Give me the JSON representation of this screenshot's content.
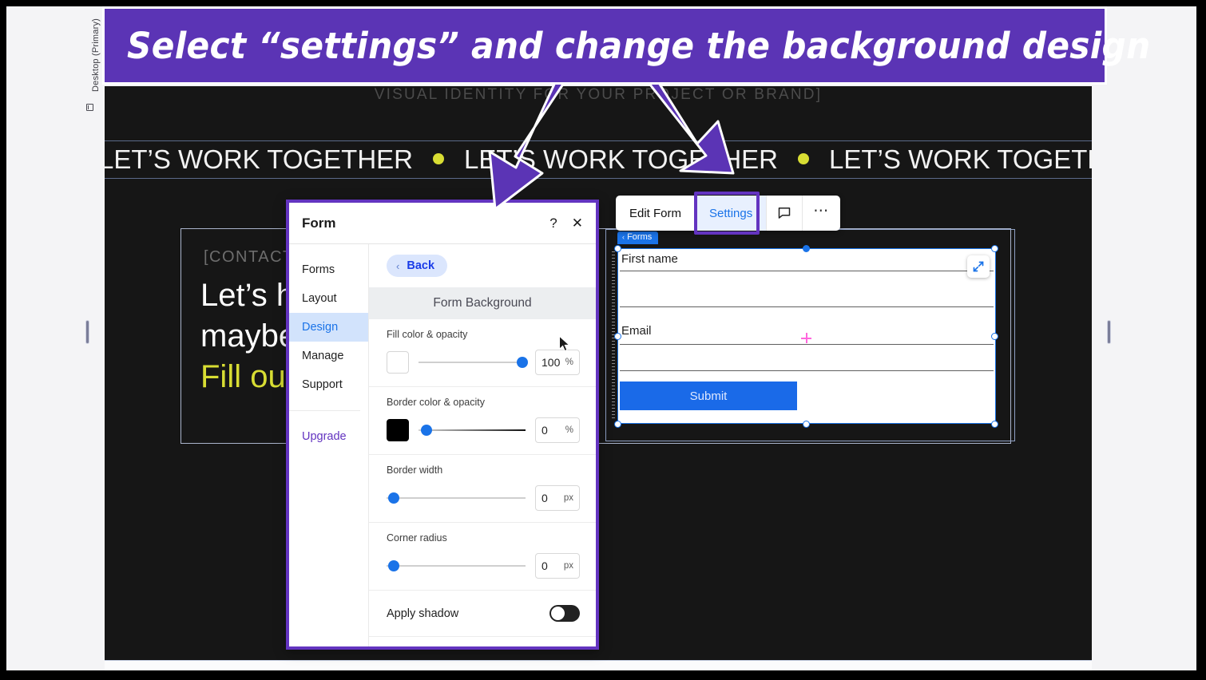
{
  "annotation": {
    "banner_text": "Select “settings” and change the background design",
    "banner_color": "#5b34b5",
    "arrow_color": "#5b34b5"
  },
  "editor": {
    "viewport_label": "Desktop (Primary)",
    "viewport_icon": "monitor-icon"
  },
  "site": {
    "eyebrow": "VISUAL IDENTITY FOR YOUR PROJECT OR BRAND]",
    "marquee_text": "LET’S WORK TOGETHER",
    "marquee_dot_color": "#d8dd33",
    "contact_tag": "[CONTACT]",
    "heading_line1": "Let’s have a chat,",
    "heading_line2": "maybe a coffee?",
    "heading_line3_highlight": "Fill out the form"
  },
  "toolbar": {
    "edit_form": "Edit Form",
    "settings": "Settings",
    "comment_icon": "comment-icon",
    "more_icon": "more-options-icon",
    "active_tab": "Settings",
    "active_color": "#1a73e8"
  },
  "form_widget": {
    "tag": "Forms",
    "field_first_name": "First name",
    "field_email": "Email",
    "submit_label": "Submit",
    "submit_color": "#1a6ae8",
    "expand_icon": "expand-icon",
    "center_marker": "center-crosshair-icon"
  },
  "panel": {
    "title": "Form",
    "help_icon": "?",
    "close_icon": "✕",
    "nav": [
      {
        "label": "Forms",
        "active": false
      },
      {
        "label": "Layout",
        "active": false
      },
      {
        "label": "Design",
        "active": true
      },
      {
        "label": "Manage",
        "active": false
      },
      {
        "label": "Support",
        "active": false
      }
    ],
    "upgrade": "Upgrade",
    "back_label": "Back",
    "back_chevron": "‹",
    "section_title": "Form Background",
    "controls": [
      {
        "label": "Fill color & opacity",
        "swatch": "#ffffff",
        "value": "100",
        "unit": "%",
        "knob_pct": 92
      },
      {
        "label": "Border color & opacity",
        "swatch": "#000000",
        "value": "0",
        "unit": "%",
        "knob_pct": 3
      },
      {
        "label": "Border width",
        "value": "0",
        "unit": "px",
        "knob_pct": 2
      },
      {
        "label": "Corner radius",
        "value": "0",
        "unit": "px",
        "knob_pct": 2
      }
    ],
    "shadow_toggle": {
      "label": "Apply shadow",
      "state": "off"
    }
  }
}
